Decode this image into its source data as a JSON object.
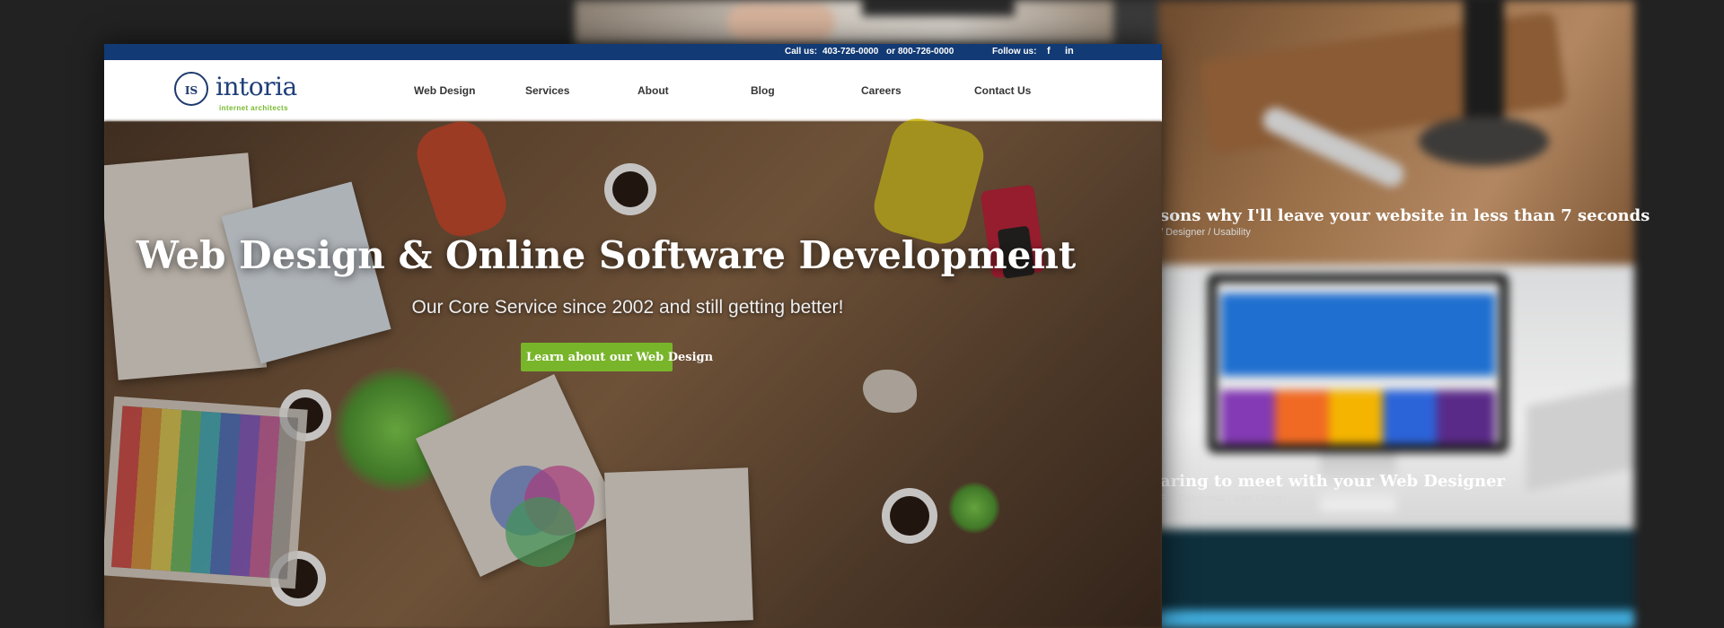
{
  "utility_bar": {
    "call_label": "Call us:",
    "phone_primary": "403-726-0000",
    "phone_separator": "or",
    "phone_secondary": "800-726-0000",
    "follow_label": "Follow us:",
    "icons": [
      "facebook-icon",
      "linkedin-icon"
    ]
  },
  "logo": {
    "mark_text": "IS",
    "name": "intoria",
    "tagline": "internet architects"
  },
  "nav": {
    "items": [
      "Web Design",
      "Services",
      "About",
      "Blog",
      "Careers",
      "Contact Us"
    ]
  },
  "hero": {
    "title": "Web Design & Online Software Development",
    "subtitle": "Our Core Service since 2002 and still getting better!",
    "cta": "Learn about our Web Design",
    "cta_color": "#79b52b"
  },
  "side_cards": [
    {
      "title": "sons why I'll leave your website in less than 7 seconds",
      "meta": "/ Designer / Usability"
    },
    {
      "title": "aring to meet with your Web Designer",
      "meta": "Pro Gabrowski / Web Design"
    }
  ],
  "colors": {
    "brand_navy": "#123a74",
    "accent_green": "#79b52b",
    "page_bg": "#262626"
  }
}
